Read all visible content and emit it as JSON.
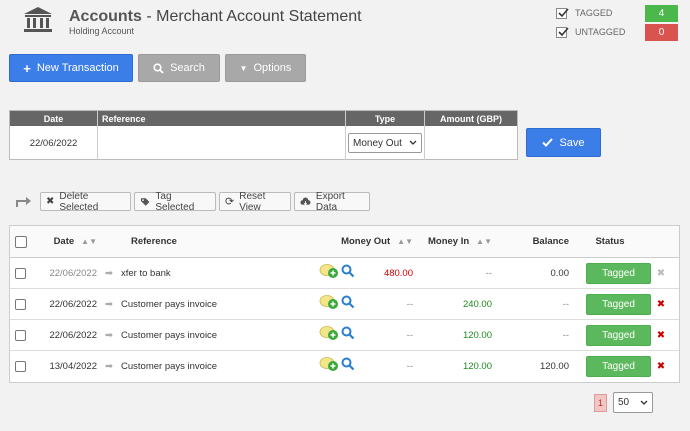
{
  "header": {
    "title": "Accounts",
    "title_sep": " - ",
    "page_name": "Merchant Account Statement",
    "subtitle": "Holding Account"
  },
  "tag_summary": [
    {
      "label": "TAGGED",
      "count": "4",
      "color": "#4cb84c"
    },
    {
      "label": "UNTAGGED",
      "count": "0",
      "color": "#d9534f"
    }
  ],
  "toolbar": {
    "new_transaction": "New Transaction",
    "search": "Search",
    "options": "Options"
  },
  "entry_form": {
    "headers": [
      "Date",
      "Reference",
      "Type",
      "Amount (GBP)"
    ],
    "date": "22/06/2022",
    "reference": "",
    "type": "Money Out",
    "amount": "",
    "save": "Save"
  },
  "actions": {
    "delete_selected": "Delete Selected",
    "tag_selected": "Tag Selected",
    "reset_view": "Reset View",
    "export_data": "Export Data"
  },
  "table": {
    "headers": {
      "date": "Date",
      "reference": "Reference",
      "money_out": "Money Out",
      "money_in": "Money In",
      "balance": "Balance",
      "status": "Status"
    },
    "rows": [
      {
        "date": "22/06/2022",
        "reference": "xfer to bank",
        "money_out": "480.00",
        "money_in": "--",
        "balance": "0.00",
        "status": "Tagged"
      },
      {
        "date": "22/06/2022",
        "reference": "Customer pays invoice",
        "money_out": "--",
        "money_in": "240.00",
        "balance": "--",
        "status": "Tagged"
      },
      {
        "date": "22/06/2022",
        "reference": "Customer pays invoice",
        "money_out": "--",
        "money_in": "120.00",
        "balance": "--",
        "status": "Tagged"
      },
      {
        "date": "13/04/2022",
        "reference": "Customer pays invoice",
        "money_out": "--",
        "money_in": "120.00",
        "balance": "120.00",
        "status": "Tagged"
      }
    ]
  },
  "pagination": {
    "current_page": "1",
    "page_size": "50"
  },
  "colors": {
    "primary": "#3c7ee8",
    "success": "#5cb85c",
    "danger": "#cc0000"
  }
}
